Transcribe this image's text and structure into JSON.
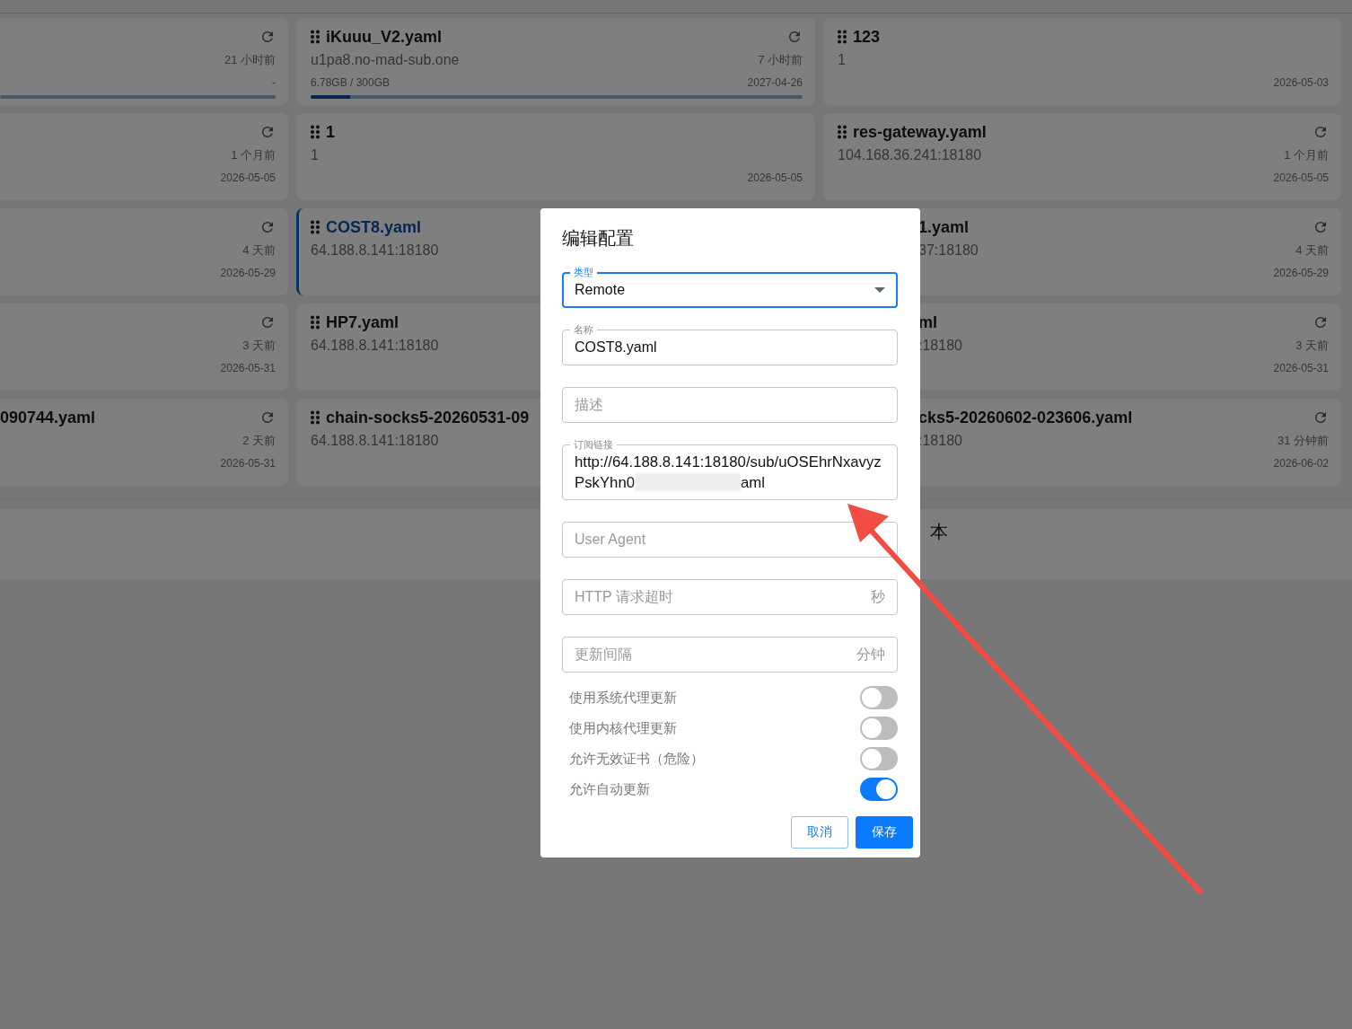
{
  "cards": [
    {
      "time": "21 小时前",
      "date": "-",
      "level": 0,
      "selected": false
    },
    {
      "title": "iKuuu_V2.yaml",
      "subtitle": "u1pa8.no-mad-sub.one",
      "time": "7 小时前",
      "usage": "6.78GB / 300GB",
      "date": "2027-04-26",
      "level": 0.08,
      "selected": false
    },
    {
      "title": "123",
      "subtitle": "1",
      "date": "2026-05-03",
      "selected": false
    },
    {
      "time": "1 个月前",
      "date": "2026-05-05",
      "selected": false
    },
    {
      "title": "1",
      "subtitle": "1",
      "date": "2026-05-05",
      "selected": false
    },
    {
      "title": "res-gateway.yaml",
      "subtitle": "104.168.36.241:18180",
      "time": "1 个月前",
      "date": "2026-05-05",
      "selected": false
    },
    {
      "time": "4 天前",
      "date": "2026-05-29",
      "selected": false
    },
    {
      "title": "COST8.yaml",
      "subtitle": "64.188.8.141:18180",
      "selected": true
    },
    {
      "title": "1.yaml",
      "subtitle": "37:18180",
      "time": "4 天前",
      "date": "2026-05-29",
      "selected": false
    },
    {
      "time": "3 天前",
      "date": "2026-05-31",
      "selected": false
    },
    {
      "title": "HP7.yaml",
      "subtitle": "64.188.8.141:18180",
      "selected": false
    },
    {
      "title": "ml",
      "subtitle": ":18180",
      "time": "3 天前",
      "date": "2026-05-31",
      "selected": false
    },
    {
      "title": "090744.yaml",
      "time": "2 天前",
      "date": "2026-05-31",
      "selected": false
    },
    {
      "title": "chain-socks5-20260531-09",
      "subtitle": "64.188.8.141:18180",
      "selected": false
    },
    {
      "title": "cks5-20260602-023606.yaml",
      "subtitle": ":18180",
      "time": "31 分钟前",
      "date": "2026-06-02",
      "selected": false
    }
  ],
  "section": {
    "text": "本"
  },
  "dialog": {
    "title": "编辑配置",
    "fields": [
      {
        "kind": "select",
        "label": "类型",
        "value": "Remote",
        "focused": true
      },
      {
        "kind": "text",
        "label": "名称",
        "value": "COST8.yaml",
        "focused": false
      },
      {
        "kind": "text",
        "placeholder": "描述",
        "focused": false
      },
      {
        "kind": "url",
        "label": "订阅链接",
        "value": "http://64.188.8.141:18180/sub/uOSEhrNxavyzPskYhn0",
        "value_end": "aml",
        "redacted": true,
        "focused": false
      },
      {
        "kind": "text",
        "placeholder": "User Agent",
        "focused": false
      },
      {
        "kind": "text",
        "placeholder": "HTTP 请求超时",
        "unit": "秒",
        "focused": false
      },
      {
        "kind": "text",
        "placeholder": "更新间隔",
        "unit": "分钟",
        "focused": false
      }
    ],
    "toggles": [
      {
        "label": "使用系统代理更新",
        "on": false
      },
      {
        "label": "使用内核代理更新",
        "on": false
      },
      {
        "label": "允许无效证书（危险）",
        "on": false
      },
      {
        "label": "允许自动更新",
        "on": true
      }
    ],
    "buttons": [
      {
        "label": "取消",
        "kind": "secondary"
      },
      {
        "label": "保存",
        "kind": "primary"
      }
    ]
  },
  "annotations": [
    {
      "kind": "arrow"
    }
  ]
}
